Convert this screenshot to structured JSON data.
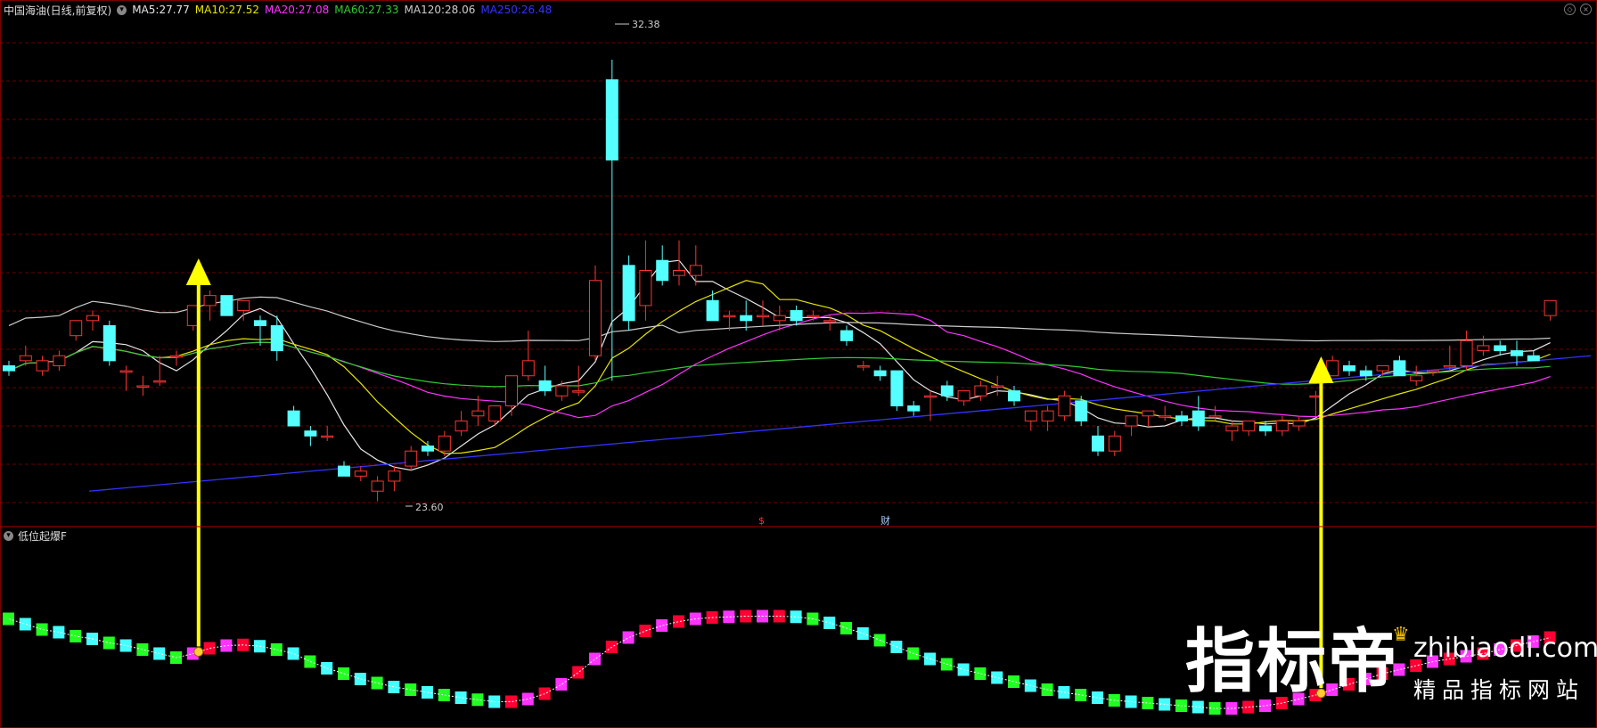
{
  "header": {
    "title": "中国海油(日线,前复权)",
    "ma": [
      {
        "label": "MA5:",
        "value": "27.77",
        "color": "#e6e6e6"
      },
      {
        "label": "MA10:",
        "value": "27.52",
        "color": "#e6e600"
      },
      {
        "label": "MA20:",
        "value": "27.08",
        "color": "#ff33ff"
      },
      {
        "label": "MA60:",
        "value": "27.33",
        "color": "#33cc33"
      },
      {
        "label": "MA120:",
        "value": "28.06",
        "color": "#cccccc"
      },
      {
        "label": "MA250:",
        "value": "26.48",
        "color": "#3333ff"
      }
    ]
  },
  "price_marks": {
    "high": "32.38",
    "low": "23.60"
  },
  "event_marks": {
    "dollar": "$",
    "finance": "财"
  },
  "indicator": {
    "name": "低位起爆F"
  },
  "watermark": {
    "logo": "指标帝",
    "url": "zhibiaodi.com",
    "slogan": "精品指标网站"
  },
  "chart_data": {
    "type": "candlestick",
    "colors": {
      "up": "#ff3333",
      "down": "#55ffff",
      "background": "#000000",
      "grid": "#6a0000"
    },
    "ohlc": [
      [
        26.3,
        26.4,
        26.1,
        26.2
      ],
      [
        26.4,
        26.7,
        26.3,
        26.5
      ],
      [
        26.2,
        26.5,
        26.1,
        26.4
      ],
      [
        26.3,
        26.6,
        26.2,
        26.5
      ],
      [
        26.9,
        27.2,
        26.8,
        27.2
      ],
      [
        27.2,
        27.4,
        27.0,
        27.3
      ],
      [
        27.1,
        27.2,
        26.3,
        26.4
      ],
      [
        26.2,
        26.3,
        25.8,
        26.2
      ],
      [
        25.9,
        26.1,
        25.7,
        25.9
      ],
      [
        26.0,
        26.5,
        25.9,
        26.0
      ],
      [
        26.5,
        26.6,
        26.3,
        26.5
      ],
      [
        27.1,
        27.5,
        27.0,
        27.5
      ],
      [
        27.5,
        27.8,
        27.2,
        27.7
      ],
      [
        27.7,
        27.7,
        27.3,
        27.3
      ],
      [
        27.4,
        27.6,
        27.2,
        27.6
      ],
      [
        27.2,
        27.3,
        26.7,
        27.1
      ],
      [
        27.1,
        27.3,
        26.4,
        26.6
      ],
      [
        25.4,
        25.5,
        25.1,
        25.1
      ],
      [
        25.0,
        25.1,
        24.7,
        24.9
      ],
      [
        24.9,
        25.1,
        24.8,
        24.9
      ],
      [
        24.3,
        24.4,
        24.1,
        24.1
      ],
      [
        24.1,
        24.3,
        24.0,
        24.2
      ],
      [
        23.8,
        24.1,
        23.6,
        24.0
      ],
      [
        24.0,
        24.3,
        23.8,
        24.2
      ],
      [
        24.3,
        24.7,
        24.2,
        24.6
      ],
      [
        24.7,
        24.8,
        24.5,
        24.6
      ],
      [
        24.6,
        25.0,
        24.5,
        24.9
      ],
      [
        25.0,
        25.4,
        24.9,
        25.2
      ],
      [
        25.3,
        25.7,
        25.1,
        25.4
      ],
      [
        25.2,
        25.5,
        25.1,
        25.5
      ],
      [
        25.5,
        26.1,
        25.3,
        26.1
      ],
      [
        26.1,
        27.0,
        26.0,
        26.4
      ],
      [
        26.0,
        26.3,
        25.7,
        25.8
      ],
      [
        25.7,
        26.0,
        25.6,
        25.9
      ],
      [
        25.8,
        26.3,
        25.7,
        25.8
      ],
      [
        26.5,
        28.3,
        26.4,
        28.0
      ],
      [
        32.0,
        32.4,
        26.0,
        30.4
      ],
      [
        28.3,
        28.5,
        27.0,
        27.2
      ],
      [
        27.5,
        28.8,
        27.2,
        28.2
      ],
      [
        28.4,
        28.7,
        27.9,
        28.0
      ],
      [
        28.1,
        28.8,
        27.9,
        28.2
      ],
      [
        28.1,
        28.7,
        27.9,
        28.3
      ],
      [
        27.6,
        27.8,
        27.2,
        27.2
      ],
      [
        27.3,
        27.4,
        27.0,
        27.3
      ],
      [
        27.3,
        27.6,
        27.0,
        27.2
      ],
      [
        27.3,
        27.6,
        27.1,
        27.3
      ],
      [
        27.2,
        27.5,
        27.0,
        27.3
      ],
      [
        27.4,
        27.5,
        27.1,
        27.2
      ],
      [
        27.3,
        27.4,
        27.2,
        27.3
      ],
      [
        27.2,
        27.3,
        27.0,
        27.2
      ],
      [
        27.0,
        27.1,
        26.7,
        26.8
      ],
      [
        26.3,
        26.4,
        26.2,
        26.3
      ],
      [
        26.2,
        26.3,
        26.0,
        26.1
      ],
      [
        26.2,
        26.2,
        25.4,
        25.5
      ],
      [
        25.5,
        25.6,
        25.3,
        25.4
      ],
      [
        25.7,
        25.8,
        25.2,
        25.7
      ],
      [
        25.9,
        26.0,
        25.6,
        25.7
      ],
      [
        25.6,
        25.8,
        25.5,
        25.8
      ],
      [
        25.7,
        26.0,
        25.6,
        25.9
      ],
      [
        25.9,
        26.1,
        25.7,
        25.9
      ],
      [
        25.8,
        25.9,
        25.5,
        25.6
      ],
      [
        25.2,
        25.4,
        25.0,
        25.4
      ],
      [
        25.2,
        25.5,
        25.0,
        25.4
      ],
      [
        25.3,
        25.8,
        25.2,
        25.7
      ],
      [
        25.6,
        25.7,
        25.1,
        25.2
      ],
      [
        24.9,
        25.1,
        24.5,
        24.6
      ],
      [
        24.6,
        25.0,
        24.5,
        24.9
      ],
      [
        25.1,
        25.3,
        24.9,
        25.3
      ],
      [
        25.3,
        25.4,
        25.1,
        25.4
      ],
      [
        25.3,
        25.5,
        25.2,
        25.3
      ],
      [
        25.3,
        25.4,
        25.1,
        25.2
      ],
      [
        25.4,
        25.7,
        25.0,
        25.1
      ],
      [
        25.3,
        25.5,
        25.2,
        25.3
      ],
      [
        25.0,
        25.2,
        24.8,
        25.1
      ],
      [
        25.0,
        25.2,
        24.9,
        25.2
      ],
      [
        25.1,
        25.2,
        24.9,
        25.0
      ],
      [
        25.0,
        25.3,
        24.9,
        25.2
      ],
      [
        25.1,
        25.3,
        25.0,
        25.2
      ],
      [
        25.7,
        25.8,
        25.3,
        25.7
      ],
      [
        26.1,
        26.5,
        26.1,
        26.4
      ],
      [
        26.3,
        26.4,
        26.1,
        26.2
      ],
      [
        26.2,
        26.3,
        26.0,
        26.1
      ],
      [
        26.2,
        26.3,
        26.1,
        26.3
      ],
      [
        26.4,
        26.5,
        26.1,
        26.1
      ],
      [
        26.0,
        26.3,
        25.9,
        26.1
      ],
      [
        26.2,
        26.2,
        26.1,
        26.2
      ],
      [
        26.3,
        26.7,
        26.2,
        26.3
      ],
      [
        26.3,
        27.0,
        26.2,
        26.8
      ],
      [
        26.6,
        26.9,
        26.5,
        26.7
      ],
      [
        26.7,
        26.8,
        26.5,
        26.6
      ],
      [
        26.6,
        26.8,
        26.3,
        26.5
      ],
      [
        26.5,
        26.6,
        26.4,
        26.4
      ],
      [
        27.3,
        27.6,
        27.2,
        27.6
      ]
    ],
    "indicator_series": [
      0.58,
      0.5,
      0.42,
      0.38,
      0.32,
      0.28,
      0.22,
      0.18,
      0.12,
      0.06,
      0,
      0.06,
      0.14,
      0.18,
      0.19,
      0.17,
      0.12,
      0.06,
      -0.06,
      -0.16,
      -0.24,
      -0.32,
      -0.38,
      -0.44,
      -0.48,
      -0.52,
      -0.56,
      -0.6,
      -0.63,
      -0.66,
      -0.66,
      -0.62,
      -0.54,
      -0.4,
      -0.22,
      -0.02,
      0.16,
      0.3,
      0.4,
      0.48,
      0.54,
      0.58,
      0.6,
      0.61,
      0.62,
      0.62,
      0.62,
      0.61,
      0.58,
      0.52,
      0.44,
      0.36,
      0.26,
      0.16,
      0.06,
      -0.02,
      -0.1,
      -0.18,
      -0.24,
      -0.3,
      -0.36,
      -0.42,
      -0.48,
      -0.52,
      -0.56,
      -0.6,
      -0.64,
      -0.66,
      -0.68,
      -0.7,
      -0.72,
      -0.74,
      -0.76,
      -0.76,
      -0.74,
      -0.72,
      -0.68,
      -0.62,
      -0.56,
      -0.48,
      -0.4,
      -0.32,
      -0.24,
      -0.18,
      -0.12,
      -0.06,
      -0.02,
      0.02,
      0.06,
      0.12,
      0.18,
      0.24,
      0.3
    ],
    "signal_arrows": [
      11,
      78
    ],
    "ylim": [
      23.2,
      33.2
    ]
  }
}
